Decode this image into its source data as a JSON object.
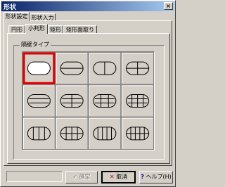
{
  "window": {
    "title": "形状",
    "close_label": "×"
  },
  "outer_tabs": [
    {
      "label": "形状設定"
    },
    {
      "label": "形状入力"
    }
  ],
  "inner_tabs": [
    {
      "label": "円形"
    },
    {
      "label": "小判形"
    },
    {
      "label": "矩形"
    },
    {
      "label": "矩形面取り"
    }
  ],
  "group": {
    "label": "隔壁タイプ",
    "selected_index": 0,
    "partition_types": [
      "none",
      "1 horizontal",
      "1 vertical",
      "1 horizontal + 1 vertical",
      "2 horizontal",
      "2 horizontal + 1 vertical",
      "2 horizontal + 2 vertical",
      "2 horizontal + 3 vertical",
      "3 vertical",
      "3 vertical + 1 horizontal",
      "4 vertical",
      "4 vertical + 1 horizontal"
    ]
  },
  "buttons": {
    "ok": {
      "label": "確定",
      "icon": "check-icon",
      "enabled": false
    },
    "cancel": {
      "label": "取消",
      "icon": "x-icon",
      "color": "#d00000"
    },
    "help": {
      "label": "ヘルプ(H)",
      "icon": "help-icon",
      "color": "#0000a0"
    }
  },
  "colors": {
    "selection": "#e00000",
    "face": "#d4d0c8"
  }
}
